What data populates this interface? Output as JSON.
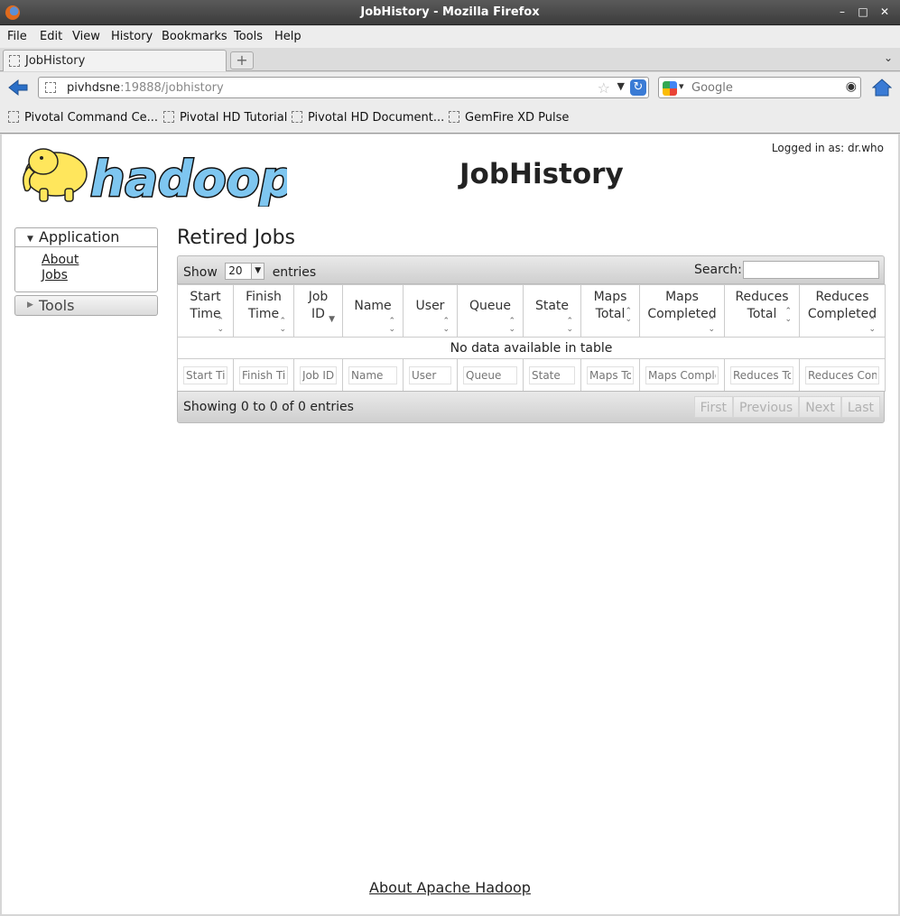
{
  "window": {
    "title": "JobHistory - Mozilla Firefox"
  },
  "menu": [
    "File",
    "Edit",
    "View",
    "History",
    "Bookmarks",
    "Tools",
    "Help"
  ],
  "tab": {
    "label": "JobHistory"
  },
  "urlbar": {
    "host": "pivhdsne",
    "path": ":19888/jobhistory"
  },
  "search": {
    "placeholder": "Google"
  },
  "bookmarks": [
    "Pivotal Command Ce...",
    "Pivotal HD Tutorial",
    "Pivotal HD Document...",
    "GemFire XD Pulse"
  ],
  "page": {
    "logged_in": "Logged in as: dr.who",
    "logo_text": "hadoop",
    "title": "JobHistory",
    "section_title": "Retired Jobs",
    "footer_link": "About Apache Hadoop"
  },
  "sidebar": {
    "application_label": "Application",
    "links": [
      "About",
      "Jobs"
    ],
    "tools_label": "Tools"
  },
  "table": {
    "show_label": "Show",
    "entries_label": "entries",
    "length_value": "20",
    "search_label": "Search:",
    "columns": [
      {
        "line1": "Start",
        "line2": "Time",
        "filter": "Start Time"
      },
      {
        "line1": "Finish",
        "line2": "Time",
        "filter": "Finish Time"
      },
      {
        "line1": "Job",
        "line2": "ID",
        "filter": "Job ID"
      },
      {
        "line1": "Name",
        "line2": "",
        "filter": "Name"
      },
      {
        "line1": "User",
        "line2": "",
        "filter": "User"
      },
      {
        "line1": "Queue",
        "line2": "",
        "filter": "Queue"
      },
      {
        "line1": "State",
        "line2": "",
        "filter": "State"
      },
      {
        "line1": "Maps",
        "line2": "Total",
        "filter": "Maps Total"
      },
      {
        "line1": "Maps",
        "line2": "Completed",
        "filter": "Maps Completed"
      },
      {
        "line1": "Reduces",
        "line2": "Total",
        "filter": "Reduces Total"
      },
      {
        "line1": "Reduces",
        "line2": "Completed",
        "filter": "Reduces Completed"
      }
    ],
    "empty_message": "No data available in table",
    "info": "Showing 0 to 0 of 0 entries",
    "pager": [
      "First",
      "Previous",
      "Next",
      "Last"
    ]
  }
}
